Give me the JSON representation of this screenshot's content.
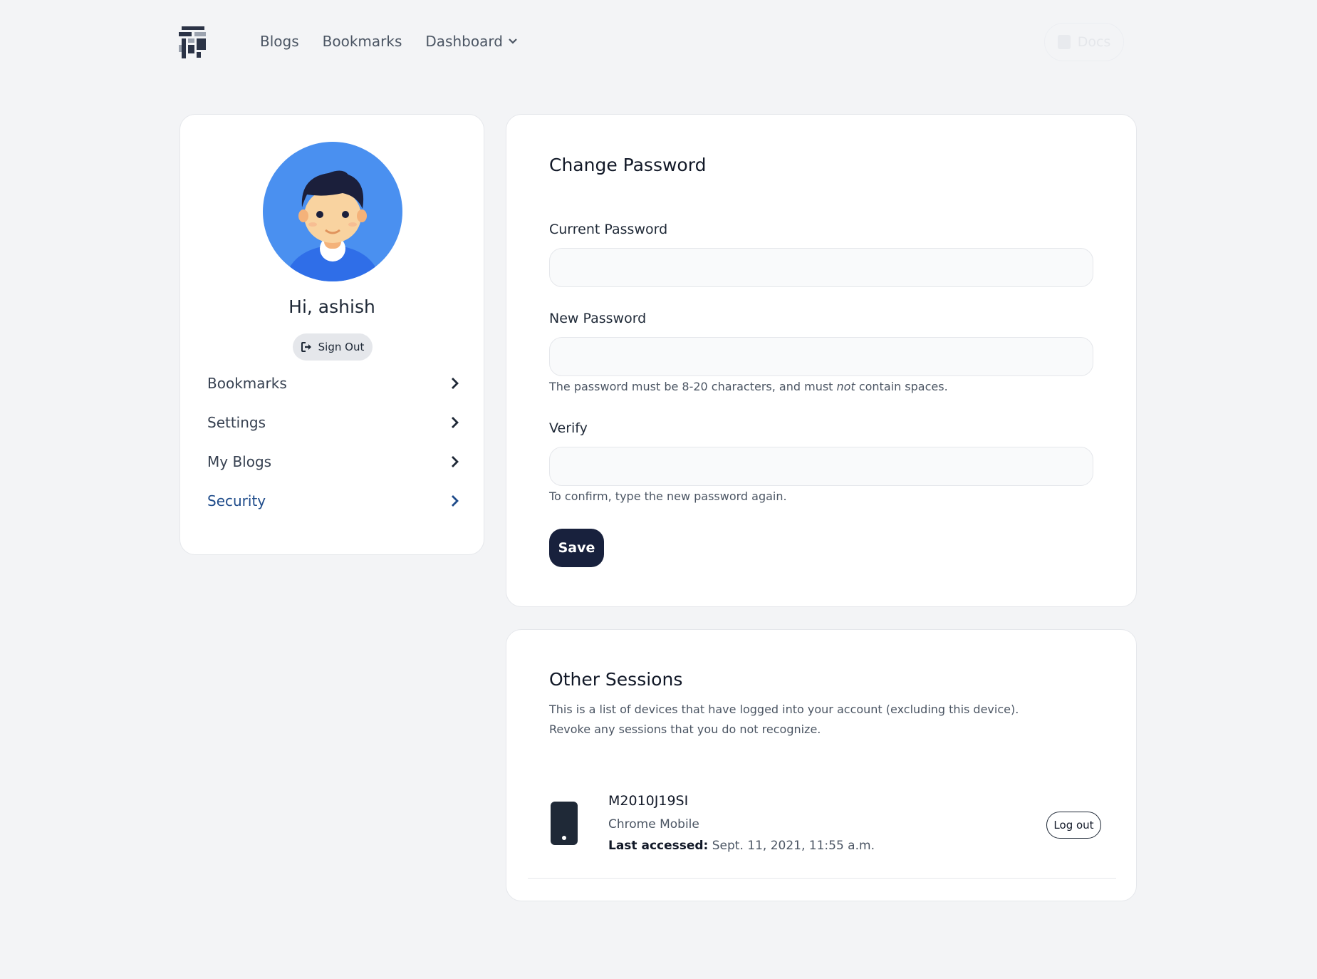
{
  "nav": {
    "links": [
      "Blogs",
      "Bookmarks"
    ],
    "dropdown_label": "Dashboard",
    "docs_label": "Docs"
  },
  "profile": {
    "greeting": "Hi, ashish",
    "signout_label": "Sign Out",
    "menu": [
      {
        "label": "Bookmarks"
      },
      {
        "label": "Settings"
      },
      {
        "label": "My Blogs"
      },
      {
        "label": "Security"
      }
    ]
  },
  "password": {
    "title": "Change Password",
    "current_label": "Current Password",
    "new_label": "New Password",
    "new_help_before": "The password must be 8-20 characters, and must ",
    "new_help_em": "not",
    "new_help_after": " contain spaces.",
    "verify_label": "Verify",
    "verify_help": "To confirm, type the new password again.",
    "save_label": "Save"
  },
  "sessions": {
    "title": "Other Sessions",
    "desc_line1": "This is a list of devices that have logged into your account (excluding this device).",
    "desc_line2": "Revoke any sessions that you do not recognize.",
    "items": [
      {
        "device": "M2010J19SI",
        "browser": "Chrome Mobile",
        "last_accessed_label": "Last accessed:",
        "last_accessed_value": " Sept. 11, 2021, 11:55 a.m.",
        "logout_label": "Log out"
      }
    ]
  },
  "colors": {
    "accent_active": "#1e4b8a",
    "primary_button": "#18213d",
    "avatar_bg": "#4a90f0"
  }
}
